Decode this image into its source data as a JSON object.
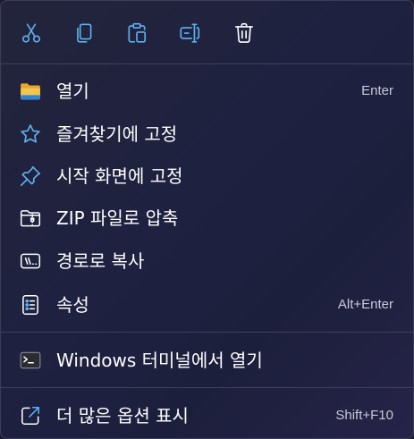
{
  "toolbar": {
    "buttons": [
      {
        "name": "cut",
        "icon": "scissors-icon"
      },
      {
        "name": "copy",
        "icon": "copy-icon"
      },
      {
        "name": "paste",
        "icon": "paste-icon"
      },
      {
        "name": "rename",
        "icon": "rename-icon"
      },
      {
        "name": "delete",
        "icon": "trash-icon"
      }
    ]
  },
  "menu": {
    "open": {
      "label": "열기",
      "shortcut": "Enter",
      "icon": "folder-icon"
    },
    "pin_favorites": {
      "label": "즐겨찾기에 고정",
      "icon": "star-icon"
    },
    "pin_start": {
      "label": "시작 화면에 고정",
      "icon": "pin-icon"
    },
    "zip": {
      "label": "ZIP 파일로 압축",
      "icon": "zip-folder-icon"
    },
    "copy_path": {
      "label": "경로로 복사",
      "icon": "path-icon"
    },
    "properties": {
      "label": "속성",
      "shortcut": "Alt+Enter",
      "icon": "properties-icon"
    },
    "terminal": {
      "label": "Windows 터미널에서 열기",
      "icon": "terminal-icon"
    },
    "more_options": {
      "label": "더 많은 옵션 표시",
      "shortcut": "Shift+F10",
      "icon": "expand-icon"
    }
  },
  "colors": {
    "accent": "#5fb2f2",
    "folder": "#f2c04f",
    "text": "#ffffff",
    "shortcut": "#c9c9d6",
    "separator": "#3f4059"
  }
}
